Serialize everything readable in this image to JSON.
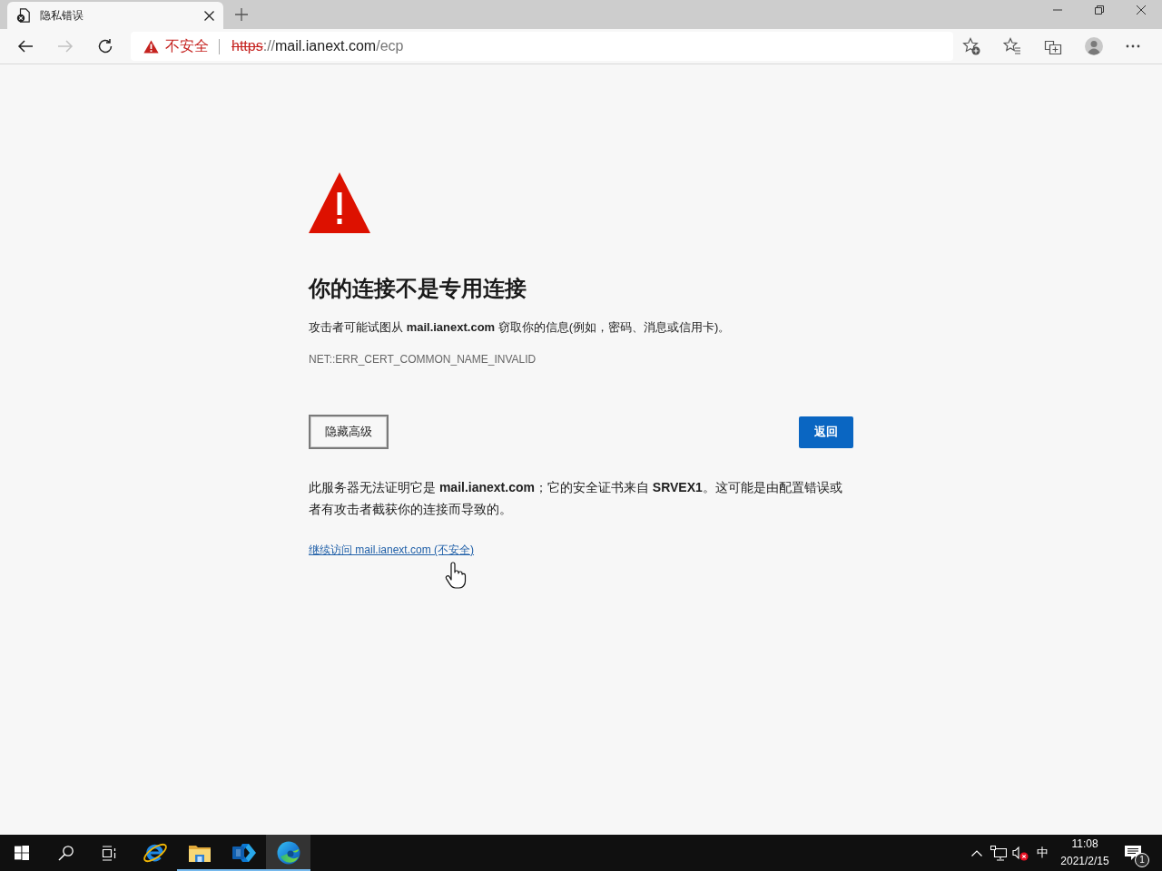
{
  "window": {
    "tab": {
      "title": "隐私错误"
    },
    "controls": [
      {
        "kind": "minimize"
      },
      {
        "kind": "restore"
      },
      {
        "kind": "close"
      }
    ]
  },
  "toolbar": {
    "nav_buttons": [
      {
        "kind": "back",
        "disabled": false
      },
      {
        "kind": "forward",
        "disabled": true
      },
      {
        "kind": "reload",
        "disabled": false
      }
    ],
    "security_label": "不安全",
    "address": {
      "scheme": "https",
      "separator": "://",
      "host": "mail.ianext.com",
      "path": "/ecp"
    },
    "actions": [
      {
        "kind": "add-favorite"
      },
      {
        "kind": "favorites"
      },
      {
        "kind": "collections"
      },
      {
        "kind": "profile"
      },
      {
        "kind": "more"
      }
    ]
  },
  "page": {
    "heading": "你的连接不是专用连接",
    "description": "攻击者可能试图从 **mail.ianext.com** 窃取你的信息(例如，密码、消息或信用卡)。",
    "error_code": "NET::ERR_CERT_COMMON_NAME_INVALID",
    "buttons": [
      {
        "label": "隐藏高级",
        "kind": "secondary"
      },
      {
        "label": "返回",
        "kind": "primary"
      }
    ],
    "details": "此服务器无法证明它是 **mail.ianext.com**；它的安全证书来自 **SRVEX1**。这可能是由配置错误或者有攻击者截获你的连接而导致的。",
    "proceed_link": "继续访问 mail.ianext.com (不安全)"
  },
  "taskbar": {
    "buttons": [
      {
        "kind": "start"
      },
      {
        "kind": "search"
      },
      {
        "kind": "task-view"
      }
    ],
    "apps": [
      {
        "kind": "ie",
        "running": false,
        "selected": false
      },
      {
        "kind": "file-explorer",
        "running": true,
        "selected": false
      },
      {
        "kind": "exchange",
        "running": true,
        "selected": false
      },
      {
        "kind": "edge",
        "running": true,
        "selected": true
      }
    ],
    "tray": {
      "volume_muted": true,
      "ime": "中",
      "time": "11:08",
      "date": "2021/2/15",
      "notification_count": "1"
    }
  }
}
